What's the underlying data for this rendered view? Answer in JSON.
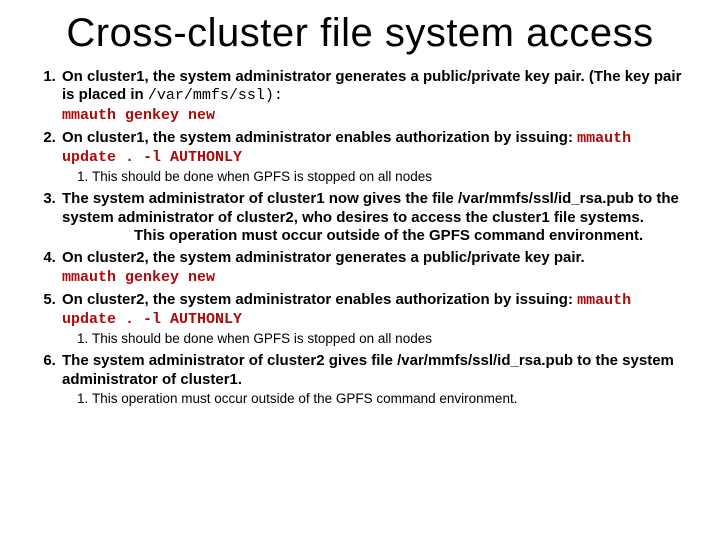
{
  "title": "Cross-cluster file system access",
  "items": [
    {
      "num": "1.",
      "text_pre": "On cluster1, the system administrator generates a public/private key pair. (The key pair is placed in ",
      "mono_black": "/var/mmfs/ssl):",
      "br": true,
      "cmd": "mmauth genkey new",
      "sub": []
    },
    {
      "num": "2.",
      "text_pre": "On cluster1, the system administrator enables authorization by issuing: ",
      "cmd": "mmauth update . -l AUTHONLY",
      "sub": [
        {
          "text": "This should be done when GPFS is stopped on all nodes"
        }
      ]
    },
    {
      "num": "3.",
      "text_pre": "The system administrator of cluster1 now gives the file /var/mmfs/ssl/id_rsa.pub to the system administrator of cluster2, who desires to access the cluster1 file systems.",
      "gap": true,
      "text_post": "This operation must occur outside of the GPFS command environment.",
      "sub": []
    },
    {
      "num": "4.",
      "text_pre": "On cluster2, the system administrator generates a public/private key pair.",
      "br": true,
      "cmd": "mmauth genkey new",
      "sub": []
    },
    {
      "num": "5.",
      "text_pre": "On cluster2, the system administrator enables authorization by issuing: ",
      "cmd": "mmauth update . -l AUTHONLY",
      "sub": [
        {
          "text": "This should be done when GPFS is stopped on all nodes"
        }
      ]
    },
    {
      "num": "6.",
      "text_pre": "The system administrator of cluster2 gives file /var/mmfs/ssl/id_rsa.pub to the system administrator of cluster1.",
      "sub": [
        {
          "text": "This operation must occur outside of the GPFS command environment."
        }
      ]
    }
  ]
}
